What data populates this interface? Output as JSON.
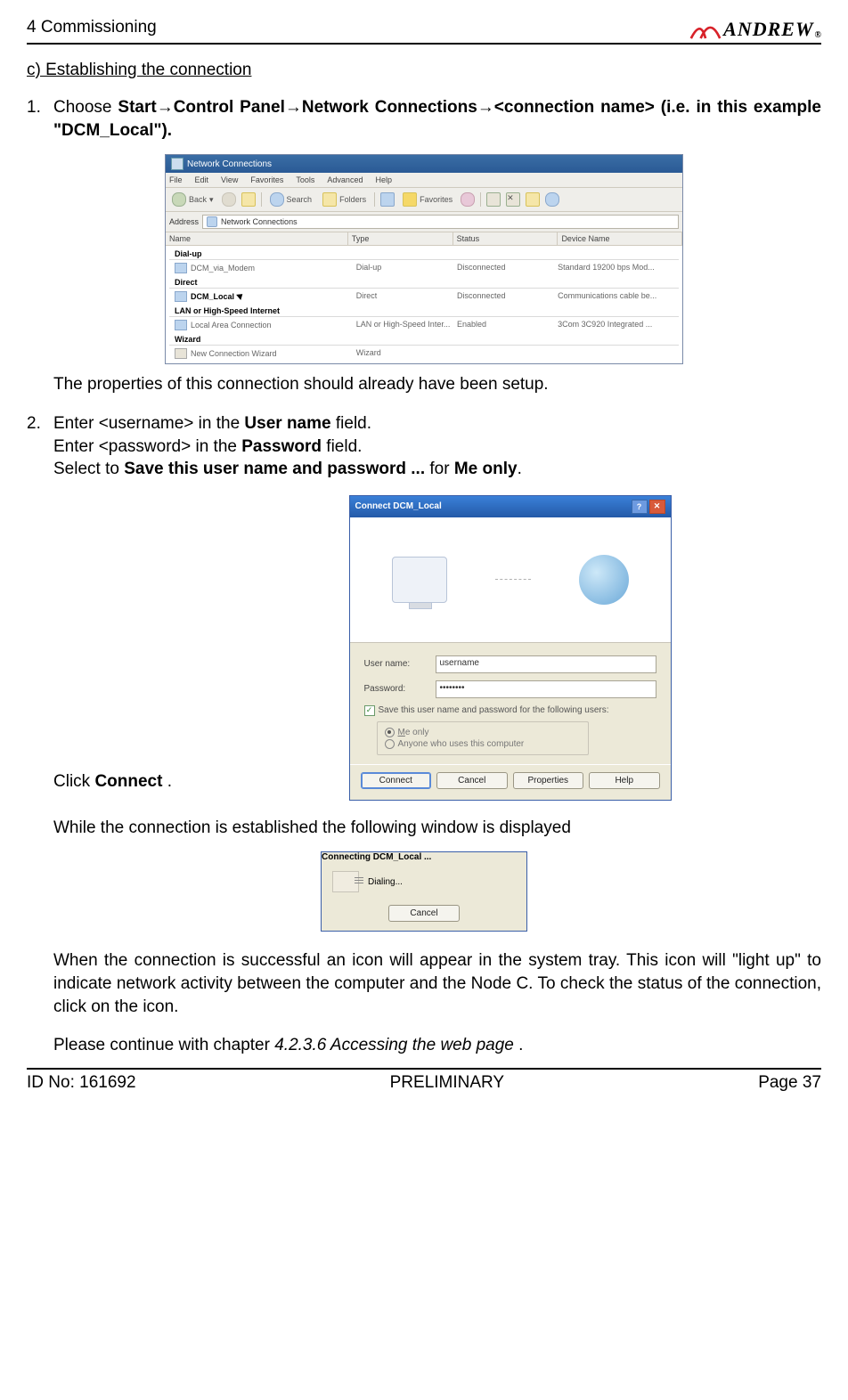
{
  "header": {
    "chapter": "4 Commissioning",
    "logo_text": "ANDREW"
  },
  "section_title": "c) Establishing the connection",
  "step1": {
    "num": "1.",
    "prefix": "Choose ",
    "b1": "Start",
    "b2": "Control Panel",
    "b3": "Network Connections",
    "b4": "<connection name>",
    "line2": "(i.e. in this example \"DCM_Local\")."
  },
  "explorer": {
    "title": "Network Connections",
    "menu": [
      "File",
      "Edit",
      "View",
      "Favorites",
      "Tools",
      "Advanced",
      "Help"
    ],
    "back": "Back",
    "search": "Search",
    "folders": "Folders",
    "favorites_btn": "Favorites",
    "addr_label": "Address",
    "addr_value": "Network Connections",
    "cols": {
      "name": "Name",
      "type": "Type",
      "status": "Status",
      "device": "Device Name"
    },
    "groups": [
      {
        "head": "Dial-up",
        "rows": [
          {
            "name": "DCM_via_Modem",
            "type": "Dial-up",
            "status": "Disconnected",
            "device": "Standard 19200 bps Mod...",
            "icon": "net"
          }
        ]
      },
      {
        "head": "Direct",
        "rows": [
          {
            "name": "DCM_Local",
            "type": "Direct",
            "status": "Disconnected",
            "device": "Communications cable be...",
            "icon": "net",
            "bold": true,
            "cursor": true
          }
        ]
      },
      {
        "head": "LAN or High-Speed Internet",
        "rows": [
          {
            "name": "Local Area Connection",
            "type": "LAN or High-Speed Inter...",
            "status": "Enabled",
            "device": "3Com 3C920 Integrated ...",
            "icon": "net"
          }
        ]
      },
      {
        "head": "Wizard",
        "rows": [
          {
            "name": "New Connection Wizard",
            "type": "Wizard",
            "status": "",
            "device": "",
            "icon": "wiz"
          }
        ]
      }
    ]
  },
  "properties_line": "The properties of this connection should already have been setup.",
  "step2": {
    "num": "2.",
    "line1a": "Enter <username> in the ",
    "line1b": "User name",
    "line1c": " field.",
    "line2a": "Enter <password> in the ",
    "line2b": "Password",
    "line2c": " field.",
    "line3a": "Select to ",
    "line3b": "Save this user name and password ...",
    "line3c": " for ",
    "line3d": "Me only",
    "line3e": "."
  },
  "connect_dialog": {
    "title": "Connect DCM_Local",
    "user_label": "User name:",
    "user_value": "username",
    "pass_label": "Password:",
    "pass_value": "••••••••",
    "chk_label": "Save this user name and password for the following users:",
    "radio_me": "Me only",
    "radio_any": "Anyone who uses this computer",
    "btn_connect": "Connect",
    "btn_cancel": "Cancel",
    "btn_props": "Properties",
    "btn_help": "Help"
  },
  "click_connect_a": "Click ",
  "click_connect_b": "Connect",
  "click_connect_c": " .",
  "while_line": "While the connection is established the following window is displayed",
  "connecting_dialog": {
    "title": "Connecting DCM_Local ...",
    "status": "Dialing...",
    "cancel": "Cancel"
  },
  "success_para": "When the connection is successful an icon will appear in the system tray. This icon will \"light up\" to indicate network activity between the computer and the Node C. To check the status of the connection, click on the icon.",
  "continue_a": "Please continue with chapter ",
  "continue_b": "4.2.3.6 Accessing the web page",
  "continue_c": " .",
  "footer": {
    "id": "ID No: 161692",
    "mid": "PRELIMINARY",
    "page": "Page 37"
  }
}
